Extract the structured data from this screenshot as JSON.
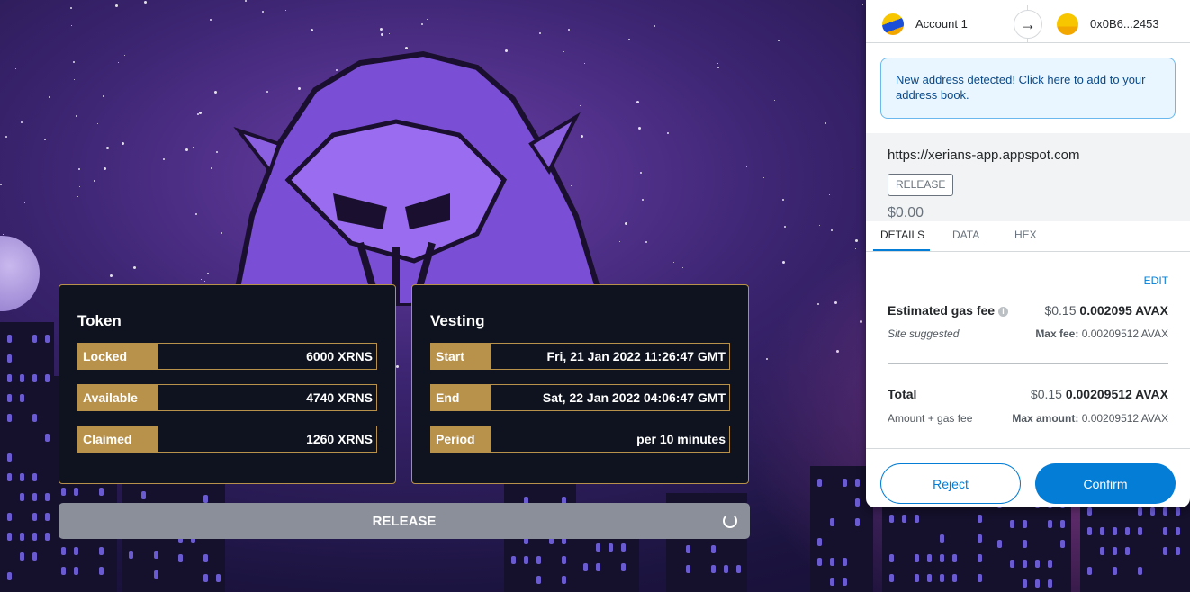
{
  "token_card": {
    "title": "Token",
    "rows": [
      {
        "label": "Locked",
        "value": "6000 XRNS"
      },
      {
        "label": "Available",
        "value": "4740 XRNS"
      },
      {
        "label": "Claimed",
        "value": "1260 XRNS"
      }
    ]
  },
  "vesting_card": {
    "title": "Vesting",
    "rows": [
      {
        "label": "Start",
        "value": "Fri, 21 Jan 2022 11:26:47 GMT"
      },
      {
        "label": "End",
        "value": "Sat, 22 Jan 2022 04:06:47 GMT"
      },
      {
        "label": "Period",
        "value": "per 10 minutes"
      }
    ]
  },
  "release_button": {
    "label": "RELEASE",
    "icon": "spinner-icon"
  },
  "wallet": {
    "from_account": "Account 1",
    "to_address": "0x0B6...2453",
    "notice": "New address detected! Click here to add to your address book.",
    "origin": "https://xerians-app.appspot.com",
    "method": "RELEASE",
    "amount": "$0.00",
    "tabs": [
      "DETAILS",
      "DATA",
      "HEX"
    ],
    "edit_label": "EDIT",
    "gas_fee": {
      "label": "Estimated gas fee",
      "fiat": "$0.15",
      "avax": "0.002095 AVAX",
      "sub_left": "Site suggested",
      "max_label": "Max fee:",
      "max_value": "0.00209512 AVAX"
    },
    "total": {
      "label": "Total",
      "fiat": "$0.15",
      "avax": "0.00209512 AVAX",
      "sub_left": "Amount + gas fee",
      "max_label": "Max amount:",
      "max_value": "0.00209512 AVAX"
    },
    "reject_label": "Reject",
    "confirm_label": "Confirm"
  },
  "colors": {
    "accent_gold": "#b8924a",
    "card_bg": "#0e131f",
    "metamask_blue": "#037dd6"
  }
}
